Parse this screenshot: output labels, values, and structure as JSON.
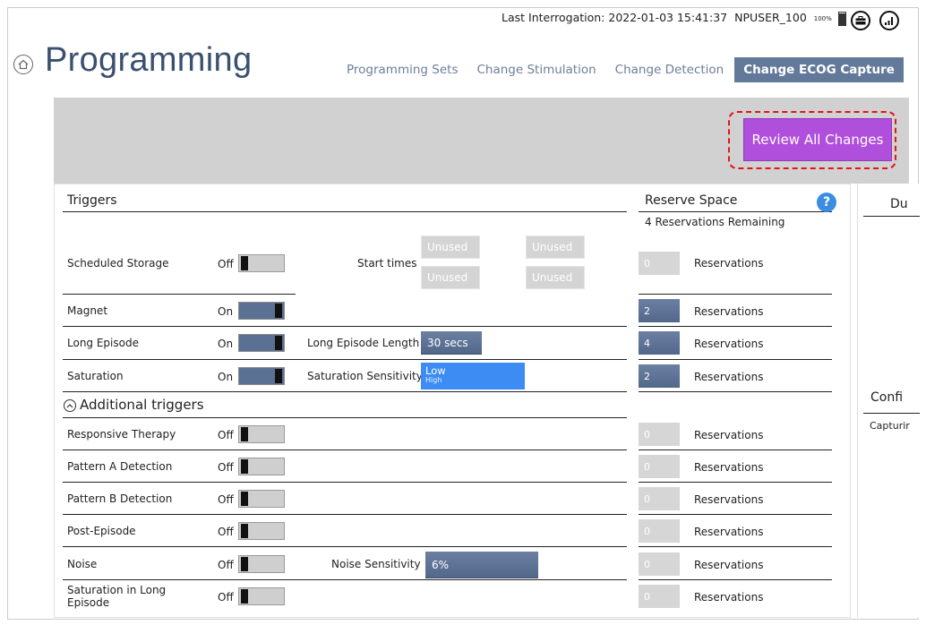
{
  "status": {
    "last_interrogation": "Last Interrogation: 2022-01-03 15:41:37",
    "user": "NPUSER_100",
    "battery_pct": "100%"
  },
  "icons": {
    "top_right": [
      "briefcase-icon",
      "signal-icon"
    ],
    "home": "home-icon",
    "help": "help-icon",
    "collapse": "chevron-up-icon"
  },
  "title": "Programming",
  "tabs": [
    {
      "label": "Programming Sets",
      "active": false
    },
    {
      "label": "Change Stimulation",
      "active": false
    },
    {
      "label": "Change Detection",
      "active": false
    },
    {
      "label": "Change ECOG Capture",
      "active": true
    }
  ],
  "review_button": "Review All Changes",
  "triggers_header": "Triggers",
  "reserve_header": "Reserve Space",
  "reservations_remaining": "4 Reservations Remaining",
  "help_glyph": "?",
  "additional_triggers": "Additional triggers",
  "start_times_label": "Start times",
  "unused_label": "Unused",
  "reservations_label": "Reservations",
  "rows": [
    {
      "name": "Scheduled Storage",
      "state": "Off",
      "reserve": "0"
    },
    {
      "name": "Magnet",
      "state": "On",
      "reserve": "2"
    },
    {
      "name": "Long Episode",
      "state": "On",
      "reserve": "4"
    },
    {
      "name": "Saturation",
      "state": "On",
      "reserve": "2"
    },
    {
      "name": "Responsive Therapy",
      "state": "Off",
      "reserve": "0"
    },
    {
      "name": "Pattern A Detection",
      "state": "Off",
      "reserve": "0"
    },
    {
      "name": "Pattern B Detection",
      "state": "Off",
      "reserve": "0"
    },
    {
      "name": "Post-Episode",
      "state": "Off",
      "reserve": "0"
    },
    {
      "name": "Noise",
      "state": "Off",
      "reserve": "0"
    },
    {
      "name": "Saturation in Long Episode",
      "state": "Off",
      "reserve": "0"
    }
  ],
  "long_episode_length": {
    "label": "Long Episode Length",
    "value": "30 secs"
  },
  "saturation_sensitivity": {
    "label": "Saturation Sensitivity",
    "value": "Low",
    "alt": "High"
  },
  "noise_sensitivity": {
    "label": "Noise Sensitivity",
    "value": "6%"
  },
  "side_panel": {
    "header1": "Du",
    "header2": "Confi",
    "text": "Capturir"
  },
  "colors": {
    "accent": "#63799a",
    "review": "#b04fdc",
    "highlight": "#e0141a",
    "saturation": "#3c8cf3"
  }
}
